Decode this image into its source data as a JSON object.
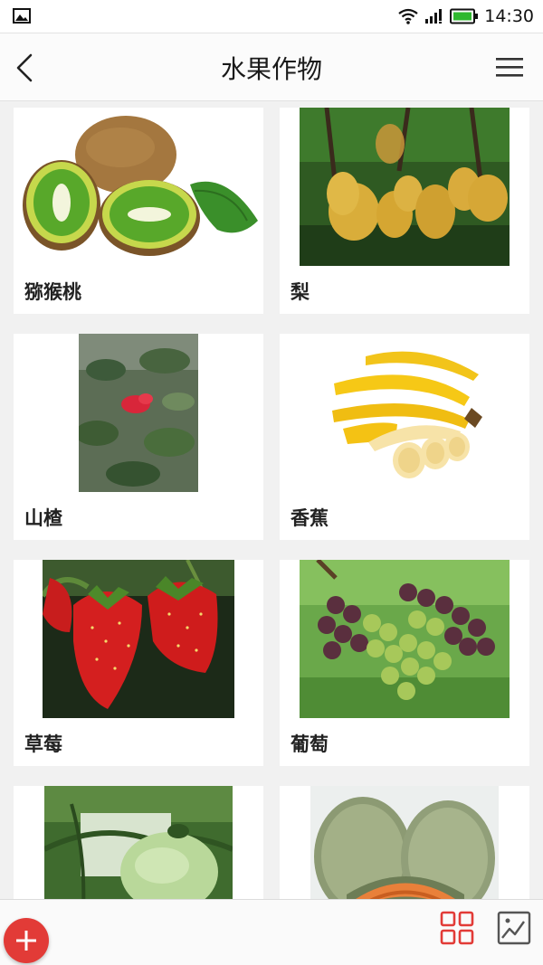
{
  "status": {
    "time": "14:30",
    "icons": [
      "image-icon",
      "wifi-icon",
      "signal-icon",
      "battery-icon"
    ]
  },
  "header": {
    "title": "水果作物",
    "back_icon": "back-chevron-icon",
    "menu_icon": "hamburger-menu-icon"
  },
  "items": [
    {
      "name": "猕猴桃"
    },
    {
      "name": "梨"
    },
    {
      "name": "山楂"
    },
    {
      "name": "香蕉"
    },
    {
      "name": "草莓"
    },
    {
      "name": "葡萄"
    },
    {
      "name": ""
    },
    {
      "name": ""
    }
  ],
  "bottom": {
    "add_icon": "plus-icon",
    "grid_icon": "grid-view-icon",
    "gallery_icon": "gallery-icon"
  },
  "colors": {
    "accent": "#e23b37",
    "battery": "#2fb82f",
    "background": "#f1f1f1"
  }
}
